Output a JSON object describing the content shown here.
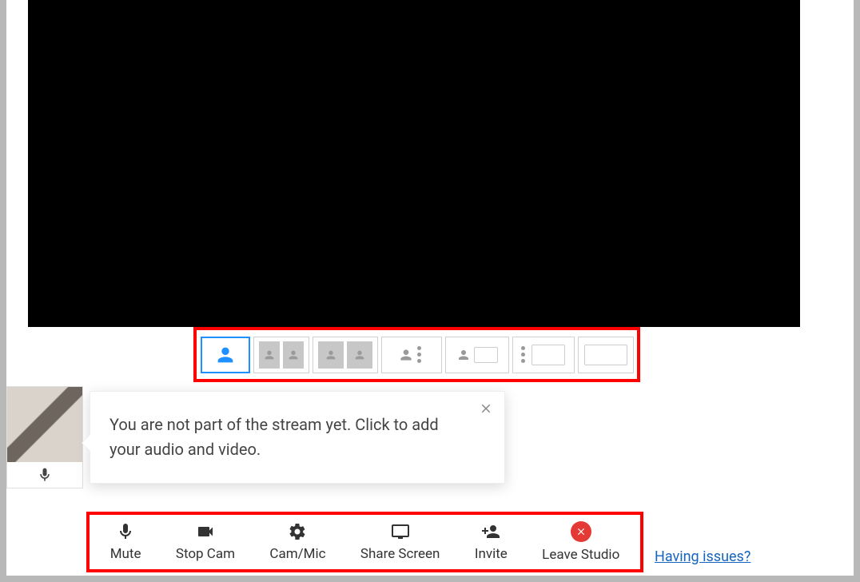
{
  "tooltip": {
    "message": "You are not part of the stream yet. Click to add your audio and video."
  },
  "controls": {
    "mute": "Mute",
    "stop_cam": "Stop Cam",
    "cam_mic": "Cam/Mic",
    "share_screen": "Share Screen",
    "invite": "Invite",
    "leave": "Leave Studio"
  },
  "footer": {
    "issues_link": "Having issues?"
  },
  "layouts": [
    {
      "id": "single",
      "active": true
    },
    {
      "id": "two-up",
      "active": false
    },
    {
      "id": "two-up-wide",
      "active": false
    },
    {
      "id": "one-plus-list",
      "active": false
    },
    {
      "id": "one-plus-screen",
      "active": false
    },
    {
      "id": "list-plus-screen",
      "active": false
    },
    {
      "id": "screen-only",
      "active": false
    }
  ]
}
